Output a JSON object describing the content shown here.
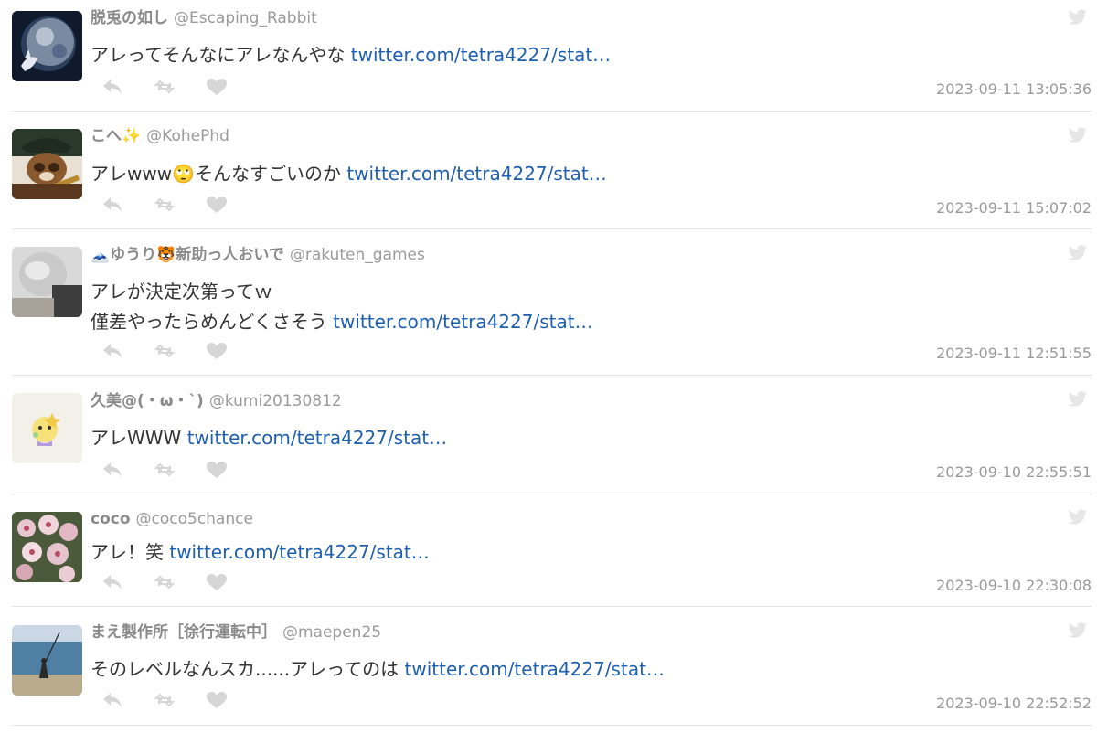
{
  "tweets": [
    {
      "display_name": "脱兎の如し",
      "handle": "@Escaping_Rabbit",
      "text_lines": [
        "アレってそんなにアレなんやな "
      ],
      "link": "twitter.com/tetra4227/stat…",
      "timestamp": "2023-09-11 13:05:36",
      "avatar_icon": "rabbit-moon-avatar"
    },
    {
      "display_name": "こへ✨",
      "handle": "@KohePhd",
      "text_lines": [
        "アレwww🙄そんなすごいのか "
      ],
      "link": "twitter.com/tetra4227/stat…",
      "timestamp": "2023-09-11 15:07:02",
      "avatar_icon": "tanuki-avatar"
    },
    {
      "display_name": "🗻ゆうり🐯新助っ人おいで",
      "handle": "@rakuten_games",
      "text_lines": [
        "アレが決定次第ってｗ",
        "僅差やったらめんどくさそう "
      ],
      "link": "twitter.com/tetra4227/stat…",
      "timestamp": "2023-09-11 12:51:55",
      "avatar_icon": "person-gray-hair-avatar"
    },
    {
      "display_name": "久美@(・ω・`)",
      "handle": "@kumi20130812",
      "text_lines": [
        "アレWWW "
      ],
      "link": "twitter.com/tetra4227/stat…",
      "timestamp": "2023-09-10 22:55:51",
      "avatar_icon": "cartoon-character-avatar"
    },
    {
      "display_name": "coco",
      "handle": "@coco5chance",
      "text_lines": [
        "アレ！笑 "
      ],
      "link": "twitter.com/tetra4227/stat…",
      "timestamp": "2023-09-10 22:30:08",
      "avatar_icon": "flowers-avatar"
    },
    {
      "display_name": "まえ製作所［徐行運転中］",
      "handle": "@maepen25",
      "text_lines": [
        "そのレベルなんスカ......アレってのは "
      ],
      "link": "twitter.com/tetra4227/stat…",
      "timestamp": "2023-09-10 22:52:52",
      "avatar_icon": "fishing-sea-avatar"
    }
  ],
  "icons": {
    "reply": "reply-icon",
    "retweet": "retweet-icon",
    "like": "heart-icon",
    "source": "twitter-bird-icon"
  },
  "colors": {
    "link": "#1f5fb0",
    "name": "#8a8a8a",
    "meta": "#9a9a9a",
    "action": "#d6d6d6",
    "divider": "#e3e3e3"
  }
}
